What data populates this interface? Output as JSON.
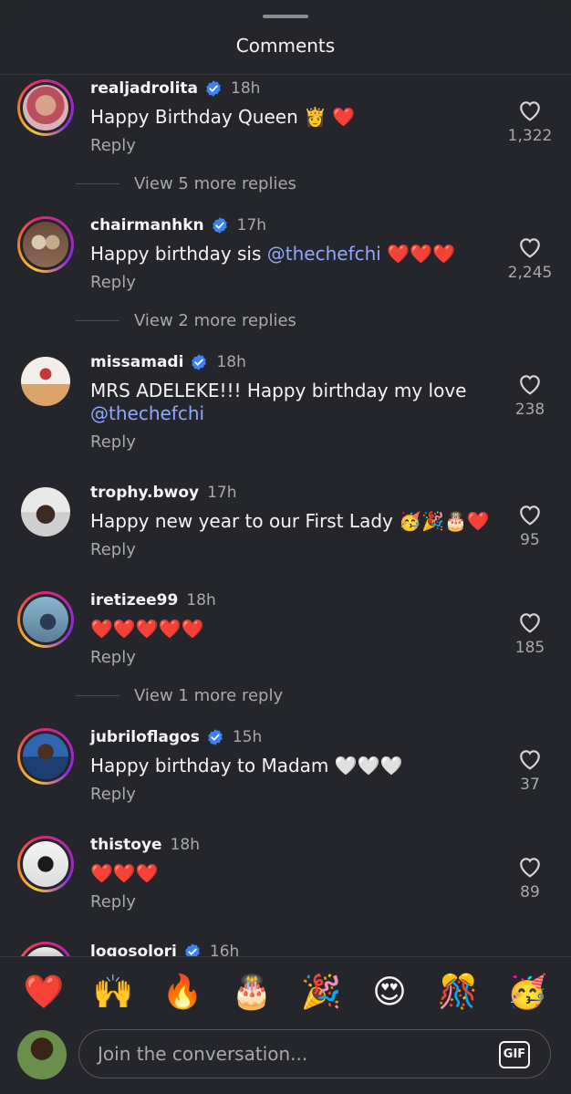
{
  "header": {
    "title": "Comments"
  },
  "comments": [
    {
      "username": "realjadrolita",
      "verified": true,
      "time": "18h",
      "text": "Happy Birthday Queen 👸 ❤️",
      "reply_label": "Reply",
      "likes": "1,322",
      "view_replies": "View 5 more replies"
    },
    {
      "username": "chairmanhkn",
      "verified": true,
      "time": "17h",
      "text_before": "Happy birthday sis ",
      "mention": "@thechefchi",
      "text_after": " ❤️❤️❤️",
      "reply_label": "Reply",
      "likes": "2,245",
      "view_replies": "View 2 more replies"
    },
    {
      "username": "missamadi",
      "verified": true,
      "time": "18h",
      "text_before": "MRS ADELEKE!!! Happy birthday my love",
      "mention": "@thechefchi",
      "reply_label": "Reply",
      "likes": "238"
    },
    {
      "username": "trophy.bwoy",
      "verified": false,
      "time": "17h",
      "text": "Happy new year to our First Lady 🥳🎉🎂❤️",
      "reply_label": "Reply",
      "likes": "95"
    },
    {
      "username": "iretizee99",
      "verified": false,
      "time": "18h",
      "text": "❤️❤️❤️❤️❤️",
      "reply_label": "Reply",
      "likes": "185",
      "view_replies": "View 1 more reply"
    },
    {
      "username": "jubriloflagos",
      "verified": true,
      "time": "15h",
      "text": "Happy birthday to Madam 🤍🤍🤍",
      "reply_label": "Reply",
      "likes": "37"
    },
    {
      "username": "thistoye",
      "verified": false,
      "time": "18h",
      "text": "❤️❤️❤️",
      "reply_label": "Reply",
      "likes": "89"
    },
    {
      "username": "logosolori",
      "verified": true,
      "time": "16h"
    }
  ],
  "quick_reactions": [
    "❤️",
    "🙌",
    "🔥",
    "🎂",
    "🎉",
    "😍",
    "🎊",
    "🥳"
  ],
  "composer": {
    "placeholder": "Join the conversation...",
    "gif_label": "GIF"
  },
  "colors": {
    "background": "#25262b",
    "mention": "#8ea8ff",
    "verified": "#3b82f6",
    "muted_text": "#a8a9ad"
  }
}
